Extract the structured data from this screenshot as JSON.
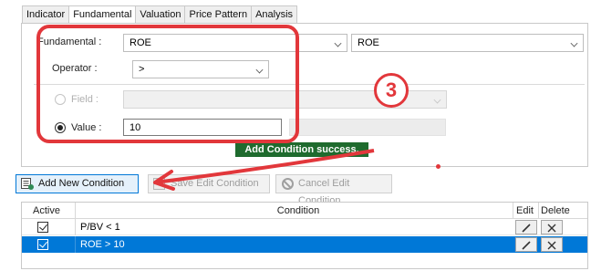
{
  "tabs": [
    {
      "label": "Indicator",
      "active": false
    },
    {
      "label": "Fundamental",
      "active": true
    },
    {
      "label": "Valuation",
      "active": false
    },
    {
      "label": "Price Pattern",
      "active": false
    },
    {
      "label": "Analysis",
      "active": false
    }
  ],
  "form": {
    "fundamental_label": "Fundamental :",
    "fundamental_value": "ROE",
    "fundamental_value_2": "ROE",
    "operator_label": "Operator :",
    "operator_value": ">",
    "field_label": "Field :",
    "field_value": "",
    "value_label": "Value :",
    "value_input": "10",
    "selected_mode": "value"
  },
  "success_message": "Add Condition success.",
  "annotation": {
    "step_number": "3",
    "color": "#e2373b"
  },
  "buttons": {
    "add_new": "Add New Condition",
    "save_edit": "Save Edit Condition",
    "cancel_edit": "Cancel Edit Condition"
  },
  "table": {
    "headers": {
      "active": "Active",
      "condition": "Condition",
      "edit": "Edit",
      "delete": "Delete"
    },
    "rows": [
      {
        "active": true,
        "condition": "P/BV < 1",
        "selected": false
      },
      {
        "active": true,
        "condition": "ROE > 10",
        "selected": true
      }
    ]
  },
  "colors": {
    "selection": "#0078d7",
    "success_bg": "#1f6b2e"
  }
}
